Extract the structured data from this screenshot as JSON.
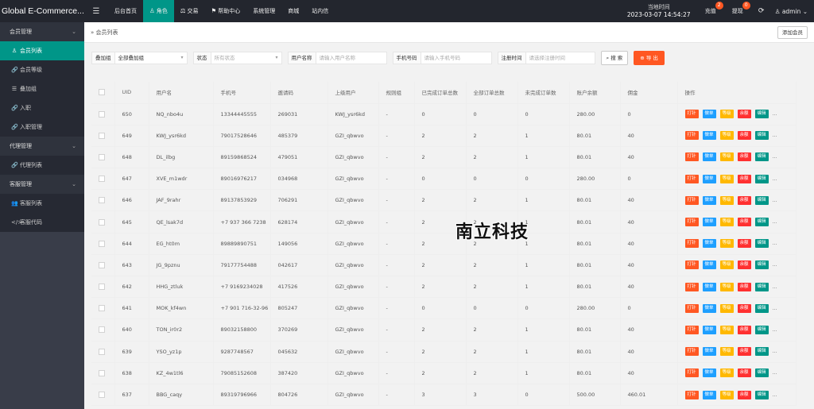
{
  "app": {
    "brand": "Global E-Commerce..."
  },
  "topnav": [
    {
      "label": "后台首页",
      "icon": ""
    },
    {
      "label": "角色",
      "icon": "user-icon",
      "glyph": "♙",
      "active": true
    },
    {
      "label": "交易",
      "icon": "scale-icon",
      "glyph": "⚖"
    },
    {
      "label": "帮助中心",
      "icon": "flag-icon",
      "glyph": "⚑"
    },
    {
      "label": "系统管理",
      "icon": ""
    },
    {
      "label": "商城",
      "icon": ""
    },
    {
      "label": "站内信",
      "icon": ""
    }
  ],
  "header": {
    "clock_label": "当地时间",
    "clock_value": "2023-03-07 14:54:27",
    "recharge_label": "充值",
    "recharge_badge": "2",
    "withdraw_label": "提现",
    "withdraw_badge": "0",
    "user": "admin"
  },
  "sidebar": {
    "groups": [
      {
        "label": "会员管理",
        "items": [
          {
            "label": "会员列表",
            "icon": "user-icon",
            "glyph": "♙",
            "active": true
          },
          {
            "label": "会员等级",
            "icon": "link-icon",
            "glyph": "🔗"
          },
          {
            "label": "叠加组",
            "icon": "list-icon",
            "glyph": "☰"
          },
          {
            "label": "入职",
            "icon": "link-icon",
            "glyph": "🔗"
          },
          {
            "label": "入职管理",
            "icon": "link-icon",
            "glyph": "🔗"
          }
        ]
      },
      {
        "label": "代理管理",
        "items": [
          {
            "label": "代理列表",
            "icon": "link-icon",
            "glyph": "🔗"
          }
        ]
      },
      {
        "label": "客服管理",
        "items": [
          {
            "label": "客服列表",
            "icon": "users-icon",
            "glyph": "👥"
          },
          {
            "label": "客服代码",
            "icon": "code-icon",
            "glyph": "</>"
          }
        ]
      }
    ]
  },
  "tab": {
    "label": "会员列表",
    "add_button": "添加会员"
  },
  "filters": {
    "overlay_label": "叠加组",
    "overlay_value": "全部叠加组",
    "status_label": "状态",
    "status_placeholder": "所有状态",
    "username_label": "用户名称",
    "username_placeholder": "请输入用户名称",
    "phone_label": "手机号码",
    "phone_placeholder": "请输入手机号码",
    "regtime_label": "注册时间",
    "regtime_placeholder": "请选择注册时间",
    "search_button": "搜 索",
    "export_button": "导 出"
  },
  "table": {
    "columns": [
      "UID",
      "用户名",
      "手机号",
      "邀请码",
      "上级用户",
      "规则组",
      "已完成订单总数",
      "全部订单总数",
      "未完成订单数",
      "账户余额",
      "佣金",
      "操作"
    ],
    "ops": [
      "打针",
      "做单",
      "等级",
      "余额",
      "编辑"
    ],
    "ops_more": "...",
    "rows": [
      [
        "650",
        "NQ_nbo4u",
        "13344445555",
        "269031",
        "KWJ_ysr6kd",
        "-",
        "0",
        "0",
        "0",
        "280.00",
        "0"
      ],
      [
        "649",
        "KWJ_ysr6kd",
        "79017528646",
        "485379",
        "GZI_qbwvo",
        "-",
        "2",
        "2",
        "1",
        "80.01",
        "40"
      ],
      [
        "648",
        "DL_ilbg",
        "89159868524",
        "479051",
        "GZI_qbwvo",
        "-",
        "2",
        "2",
        "1",
        "80.01",
        "40"
      ],
      [
        "647",
        "XVE_m1wdr",
        "89016976217",
        "034968",
        "GZI_qbwvo",
        "-",
        "0",
        "0",
        "0",
        "280.00",
        "0"
      ],
      [
        "646",
        "JAF_9rahr",
        "89137853929",
        "706291",
        "GZI_qbwvo",
        "-",
        "2",
        "2",
        "1",
        "80.01",
        "40"
      ],
      [
        "645",
        "QE_lsak7d",
        "+7 937 366 7238",
        "628174",
        "GZI_qbwvo",
        "-",
        "2",
        "2",
        "1",
        "80.01",
        "40"
      ],
      [
        "644",
        "EG_ht0m",
        "89889890751",
        "149056",
        "GZI_qbwvo",
        "-",
        "2",
        "2",
        "1",
        "80.01",
        "40"
      ],
      [
        "643",
        "JG_9pznu",
        "79177754488",
        "042617",
        "GZI_qbwvo",
        "-",
        "2",
        "2",
        "1",
        "80.01",
        "40"
      ],
      [
        "642",
        "HHG_ztluk",
        "+7 9169234028",
        "417526",
        "GZI_qbwvo",
        "-",
        "2",
        "2",
        "1",
        "80.01",
        "40"
      ],
      [
        "641",
        "MOK_kf4wn",
        "+7 901 716-32-96",
        "805247",
        "GZI_qbwvo",
        "-",
        "0",
        "0",
        "0",
        "280.00",
        "0"
      ],
      [
        "640",
        "TON_ir0r2",
        "89032158800",
        "370269",
        "GZI_qbwvo",
        "-",
        "2",
        "2",
        "1",
        "80.01",
        "40"
      ],
      [
        "639",
        "YSO_yz1p",
        "9287748567",
        "045632",
        "GZI_qbwvo",
        "-",
        "2",
        "2",
        "1",
        "80.01",
        "40"
      ],
      [
        "638",
        "KZ_4w1tl6",
        "79085152608",
        "387420",
        "GZI_qbwvo",
        "-",
        "2",
        "2",
        "1",
        "80.01",
        "40"
      ],
      [
        "637",
        "BBG_caqy",
        "89319796966",
        "804726",
        "GZI_qbwvo",
        "-",
        "3",
        "3",
        "0",
        "500.00",
        "460.01"
      ]
    ]
  },
  "watermark": "南立科技",
  "colors": {
    "accent": "#009688",
    "header_bg": "#23262e",
    "sidebar_bg": "#393d49",
    "danger": "#ff5722"
  }
}
